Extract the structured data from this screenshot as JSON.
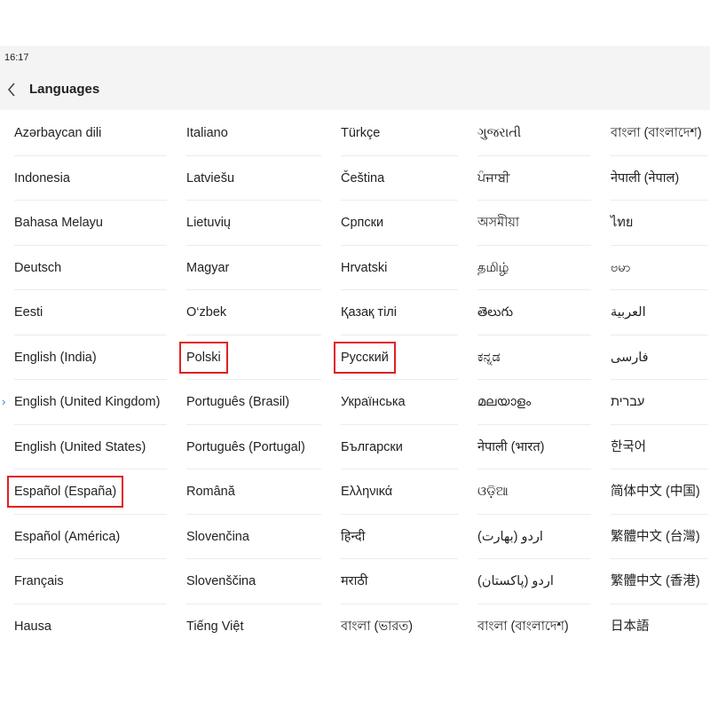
{
  "status_bar": {
    "time": "16:17"
  },
  "header": {
    "title": "Languages"
  },
  "icons": {
    "back": "chevron-left-icon",
    "selected": "chevron-right-icon"
  },
  "colors": {
    "highlight_box": "#e02020",
    "selected_indicator": "#2a8de0"
  },
  "selected_language": "English (United Kingdom)",
  "highlighted_languages": [
    "Español (España)",
    "Polski",
    "Русский"
  ],
  "columns": [
    [
      "Azərbaycan dili",
      "Indonesia",
      "Bahasa Melayu",
      "Deutsch",
      "Eesti",
      "English (India)",
      "English (United Kingdom)",
      "English (United States)",
      "Español (España)",
      "Español (América)",
      "Français",
      "Hausa"
    ],
    [
      "Italiano",
      "Latviešu",
      "Lietuvių",
      "Magyar",
      "O‘zbek",
      "Polski",
      "Português (Brasil)",
      "Português (Portugal)",
      "Română",
      "Slovenčina",
      "Slovenščina",
      "Tiếng Việt"
    ],
    [
      "Türkçe",
      "Čeština",
      "Српски",
      "Hrvatski",
      "Қазақ тілі",
      "Русский",
      "Українська",
      "Български",
      "Ελληνικά",
      "हिन्दी",
      "मराठी",
      "বাংলা (ভারত)"
    ],
    [
      "ગુજરાતી",
      "ਪੰਜਾਬੀ",
      "অসমীয়া",
      "தமிழ்",
      "తెలుగు",
      "ಕನ್ನಡ",
      "മലയാളം",
      "नेपाली (भारत)",
      "ଓଡ଼ିଆ",
      "اردو (بھارت)",
      "اردو (پاکستان)",
      "বাংলা (বাংলাদেশ)"
    ],
    [
      "বাংলা (বাংলাদেশ)",
      "नेपाली (नेपाल)",
      "ไทย",
      "ဗမာ",
      "العربية",
      "فارسی",
      "עברית",
      "한국어",
      "简体中文 (中国)",
      "繁體中文 (台灣)",
      "繁體中文 (香港)",
      "日本語"
    ]
  ]
}
